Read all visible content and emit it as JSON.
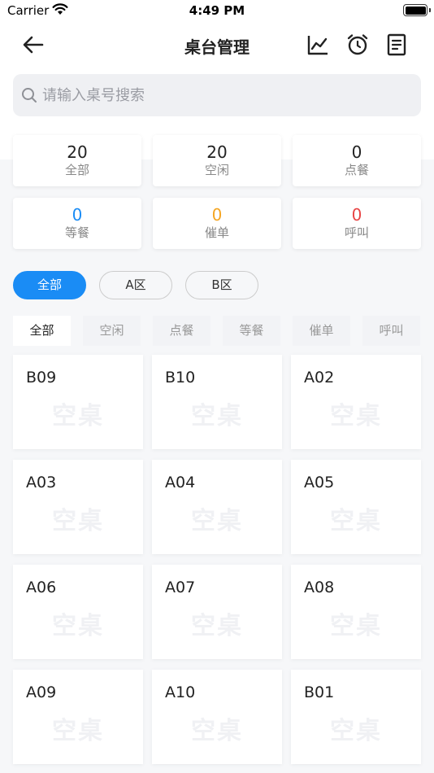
{
  "status_bar": {
    "carrier": "Carrier",
    "time": "4:49 PM"
  },
  "nav": {
    "title": "桌台管理",
    "icons": [
      "back-arrow-icon",
      "chart-line-icon",
      "alarm-clock-icon",
      "document-icon"
    ]
  },
  "search": {
    "placeholder": "请输入桌号搜索",
    "value": ""
  },
  "stats": [
    {
      "value": "20",
      "label": "全部",
      "color": "#222222"
    },
    {
      "value": "20",
      "label": "空闲",
      "color": "#222222"
    },
    {
      "value": "0",
      "label": "点餐",
      "color": "#222222"
    },
    {
      "value": "0",
      "label": "等餐",
      "color": "#1a8cf5"
    },
    {
      "value": "0",
      "label": "催单",
      "color": "#f5a623"
    },
    {
      "value": "0",
      "label": "呼叫",
      "color": "#e84545"
    }
  ],
  "areas": {
    "items": [
      "全部",
      "A区",
      "B区"
    ],
    "selected": "全部"
  },
  "filters": {
    "items": [
      "全部",
      "空闲",
      "点餐",
      "等餐",
      "催单",
      "呼叫"
    ],
    "selected": "全部"
  },
  "tables": [
    {
      "name": "B09",
      "status": "空桌"
    },
    {
      "name": "B10",
      "status": "空桌"
    },
    {
      "name": "A02",
      "status": "空桌"
    },
    {
      "name": "A03",
      "status": "空桌"
    },
    {
      "name": "A04",
      "status": "空桌"
    },
    {
      "name": "A05",
      "status": "空桌"
    },
    {
      "name": "A06",
      "status": "空桌"
    },
    {
      "name": "A07",
      "status": "空桌"
    },
    {
      "name": "A08",
      "status": "空桌"
    },
    {
      "name": "A09",
      "status": "空桌"
    },
    {
      "name": "A10",
      "status": "空桌"
    },
    {
      "name": "B01",
      "status": "空桌"
    }
  ],
  "colors": {
    "accent": "#1a8cf5",
    "background": "#f6f7f9"
  }
}
